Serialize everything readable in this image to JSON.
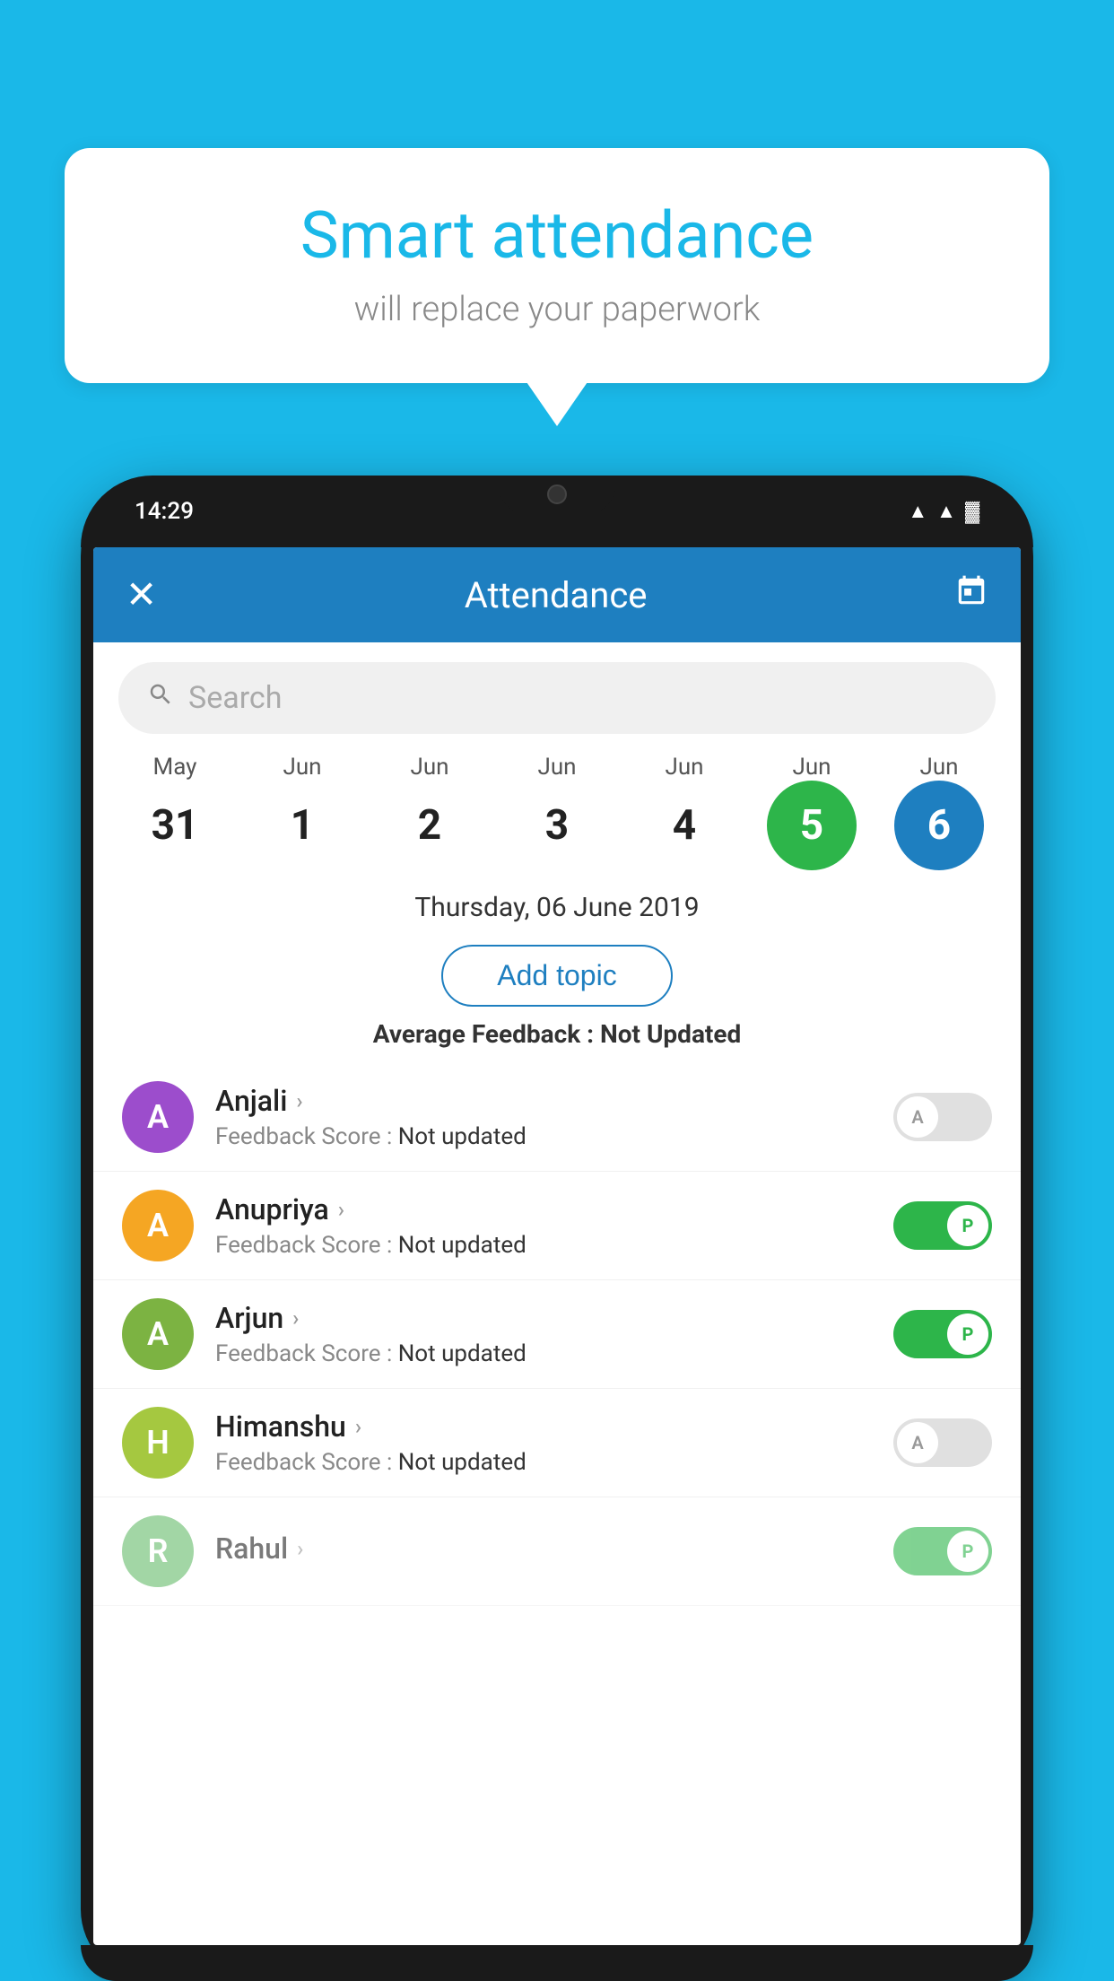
{
  "bubble": {
    "title": "Smart attendance",
    "subtitle": "will replace your paperwork"
  },
  "statusBar": {
    "time": "14:29",
    "wifi": "▲",
    "signal": "▲",
    "battery": "▓"
  },
  "header": {
    "title": "Attendance",
    "close_label": "✕",
    "calendar_label": "📅"
  },
  "search": {
    "placeholder": "Search"
  },
  "calendar": {
    "days": [
      {
        "month": "May",
        "date": "31",
        "type": "normal"
      },
      {
        "month": "Jun",
        "date": "1",
        "type": "normal"
      },
      {
        "month": "Jun",
        "date": "2",
        "type": "normal"
      },
      {
        "month": "Jun",
        "date": "3",
        "type": "normal"
      },
      {
        "month": "Jun",
        "date": "4",
        "type": "normal"
      },
      {
        "month": "Jun",
        "date": "5",
        "type": "today"
      },
      {
        "month": "Jun",
        "date": "6",
        "type": "selected"
      }
    ],
    "selected_date": "Thursday, 06 June 2019"
  },
  "add_topic": {
    "label": "Add topic"
  },
  "avg_feedback": {
    "label": "Average Feedback :",
    "value": "Not Updated"
  },
  "students": [
    {
      "name": "Anjali",
      "avatar_letter": "A",
      "avatar_color": "#9c4dcc",
      "feedback_label": "Feedback Score :",
      "feedback_value": "Not updated",
      "present": false
    },
    {
      "name": "Anupriya",
      "avatar_letter": "A",
      "avatar_color": "#f5a623",
      "feedback_label": "Feedback Score :",
      "feedback_value": "Not updated",
      "present": true
    },
    {
      "name": "Arjun",
      "avatar_letter": "A",
      "avatar_color": "#7cb342",
      "feedback_label": "Feedback Score :",
      "feedback_value": "Not updated",
      "present": true
    },
    {
      "name": "Himanshu",
      "avatar_letter": "H",
      "avatar_color": "#a5c840",
      "feedback_label": "Feedback Score :",
      "feedback_value": "Not updated",
      "present": false
    }
  ],
  "colors": {
    "bg": "#1ab8e8",
    "header": "#1e7fc0",
    "present_toggle": "#2db54a",
    "today_circle": "#2db54a",
    "selected_circle": "#1e7fc0"
  }
}
